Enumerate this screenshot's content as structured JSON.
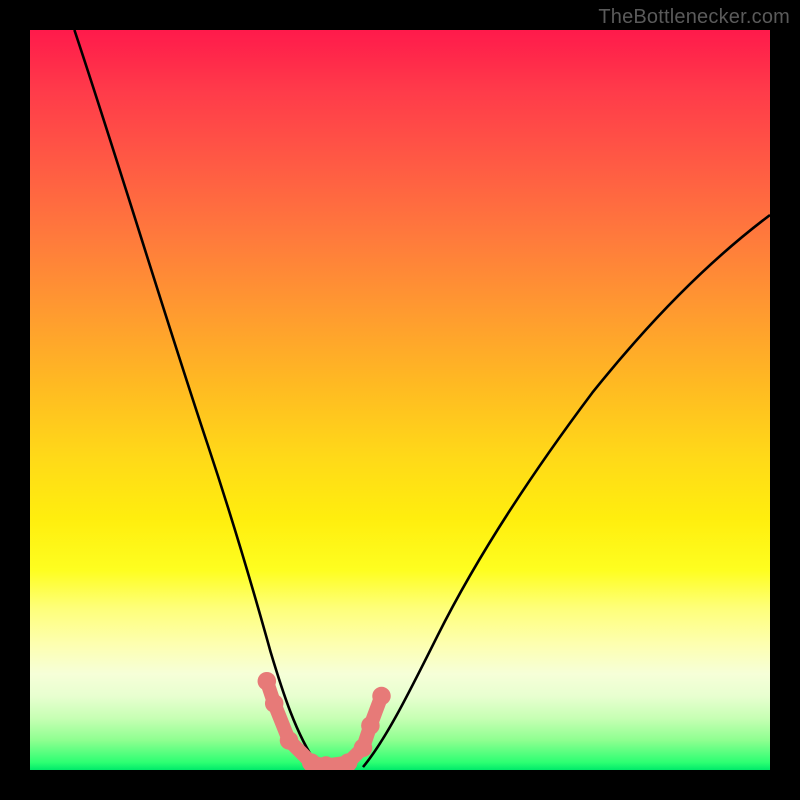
{
  "attribution": "TheBottlenecker.com",
  "chart_data": {
    "type": "line",
    "title": "",
    "xlabel": "",
    "ylabel": "",
    "xlim": [
      0,
      100
    ],
    "ylim": [
      0,
      100
    ],
    "series": [
      {
        "name": "left-curve",
        "x": [
          6,
          10,
          14,
          18,
          22,
          26,
          28,
          30,
          32,
          35,
          38,
          40
        ],
        "values": [
          100,
          89,
          77,
          65,
          53,
          40,
          33,
          25,
          17,
          8,
          2,
          0
        ]
      },
      {
        "name": "right-curve",
        "x": [
          45,
          47,
          50,
          54,
          58,
          64,
          72,
          82,
          92,
          100
        ],
        "values": [
          0,
          3,
          8,
          16,
          24,
          34,
          46,
          58,
          68,
          75
        ]
      },
      {
        "name": "valley-marker",
        "x": [
          32,
          33,
          35,
          38,
          40,
          43,
          45,
          46,
          47.5
        ],
        "values": [
          12,
          9,
          4,
          1,
          0.5,
          1,
          3,
          6,
          10
        ]
      }
    ],
    "background_gradient": {
      "top_color": "#ff1a4b",
      "mid_color": "#ffee0e",
      "bottom_color": "#00e96a"
    },
    "accent_color": "#e77a78",
    "curve_color": "#000000"
  }
}
